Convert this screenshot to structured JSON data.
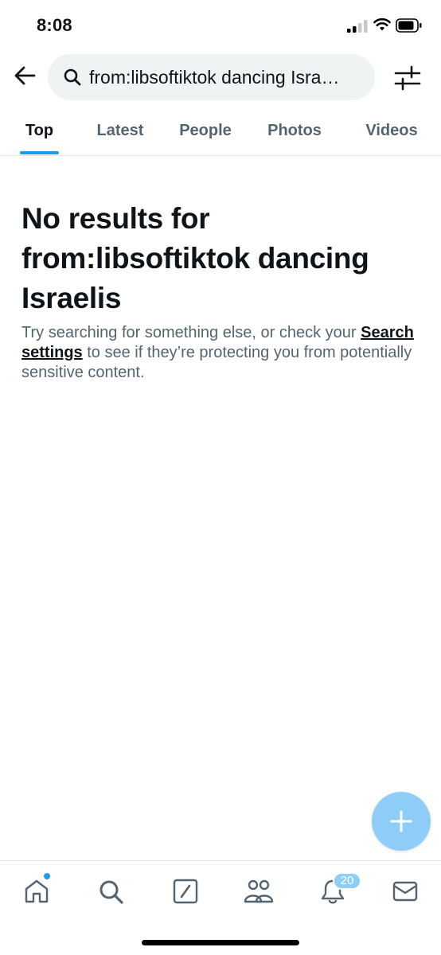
{
  "status_bar": {
    "time": "8:08",
    "signal_icon": "cellular-signal-icon",
    "wifi_icon": "wifi-icon",
    "battery_icon": "battery-icon"
  },
  "header": {
    "back_icon": "arrow-left-icon",
    "search_query": "from:libsoftiktok dancing Isra…",
    "search_icon": "search-icon",
    "filter_icon": "sliders-icon"
  },
  "tabs": [
    {
      "label": "Top",
      "active": true
    },
    {
      "label": "Latest",
      "active": false
    },
    {
      "label": "People",
      "active": false
    },
    {
      "label": "Photos",
      "active": false
    },
    {
      "label": "Videos",
      "active": false
    }
  ],
  "main": {
    "title": "No results for from:libsoftiktok dancing Israelis",
    "body_before": "Try searching for something else, or check your ",
    "body_link": "Search settings",
    "body_after": " to see if they’re protecting you from potentially sensitive content."
  },
  "fab": {
    "icon": "plus-icon"
  },
  "bottom_nav": {
    "items": [
      "home-icon",
      "search-icon",
      "grok-icon",
      "communities-icon",
      "notifications-icon",
      "messages-icon"
    ],
    "notifications_count": "20"
  },
  "colors": {
    "accent": "#1d9bf0",
    "fab": "#8ecdf8",
    "text_primary": "#0f1419",
    "text_secondary": "#536471",
    "search_bg": "#eff3f4",
    "divider": "#e3e8ea"
  }
}
